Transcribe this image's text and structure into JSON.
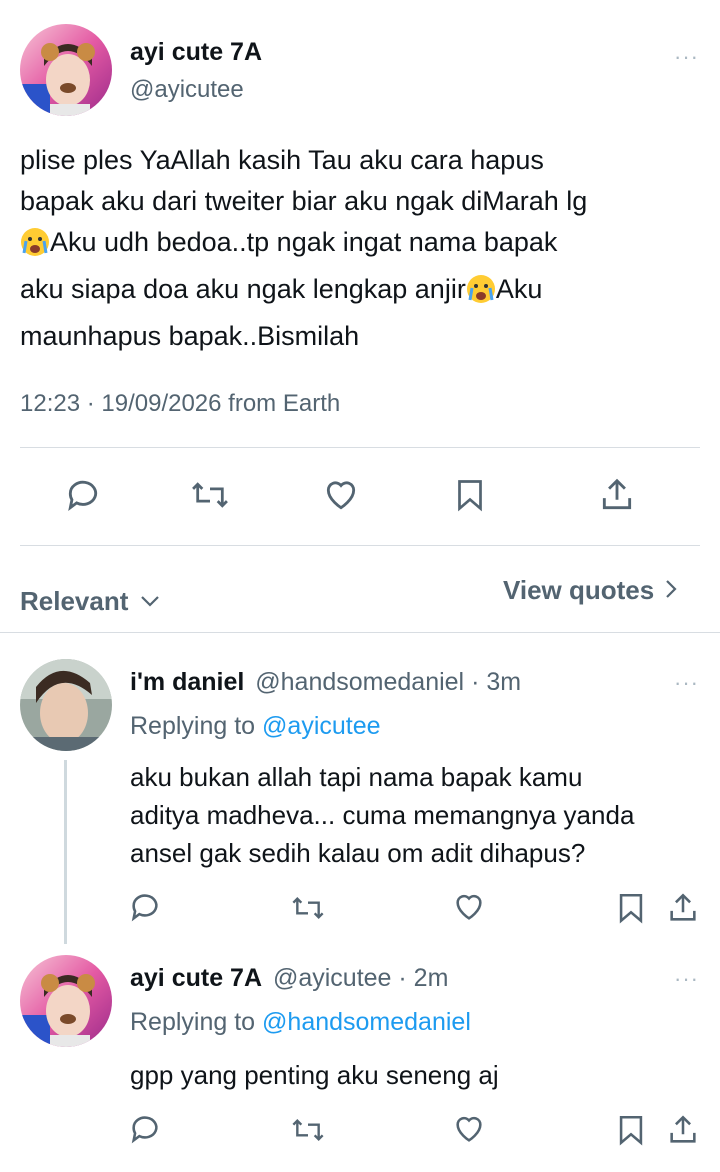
{
  "main_tweet": {
    "display_name": "ayi cute 7A",
    "handle": "@ayicutee",
    "text_lines": [
      "plise ples YaAllah kasih Tau aku cara hapus",
      "bapak aku dari tweiter biar aku ngak diMarah lg",
      "Aku udh bedoa..tp ngak ingat nama bapak",
      "aku siapa doa aku ngak lengkap anjir",
      "Aku",
      "maunhapus bapak..Bismilah"
    ],
    "emoji": "crying-face-emoji",
    "timestamp": "12:23 · 19/09/2026 from Earth",
    "more": "···"
  },
  "actions": [
    "reply-icon",
    "retweet-icon",
    "like-icon",
    "bookmark-icon",
    "share-icon"
  ],
  "sort": {
    "label": "Relevant",
    "view_quotes": "View quotes"
  },
  "replies": [
    {
      "display_name": "i'm daniel",
      "handle": "@handsomedaniel",
      "time": " · 3m",
      "replying_label": "Replying to ",
      "replying_to": "@ayicutee",
      "text_lines": [
        "aku bukan allah tapi nama bapak kamu",
        "aditya madheva... cuma memangnya yanda",
        "ansel gak sedih kalau om adit dihapus?"
      ],
      "more": "···"
    },
    {
      "display_name": "ayi cute 7A",
      "handle": "@ayicutee",
      "time": " · 2m",
      "replying_label": "Replying to ",
      "replying_to": "@handsomedaniel",
      "text_lines": [
        "gpp yang penting aku seneng aj"
      ],
      "more": "···"
    }
  ],
  "colors": {
    "accent": "#1d9bf0",
    "muted": "#536471",
    "icon": "#536471",
    "divider": "#d8dde2"
  }
}
